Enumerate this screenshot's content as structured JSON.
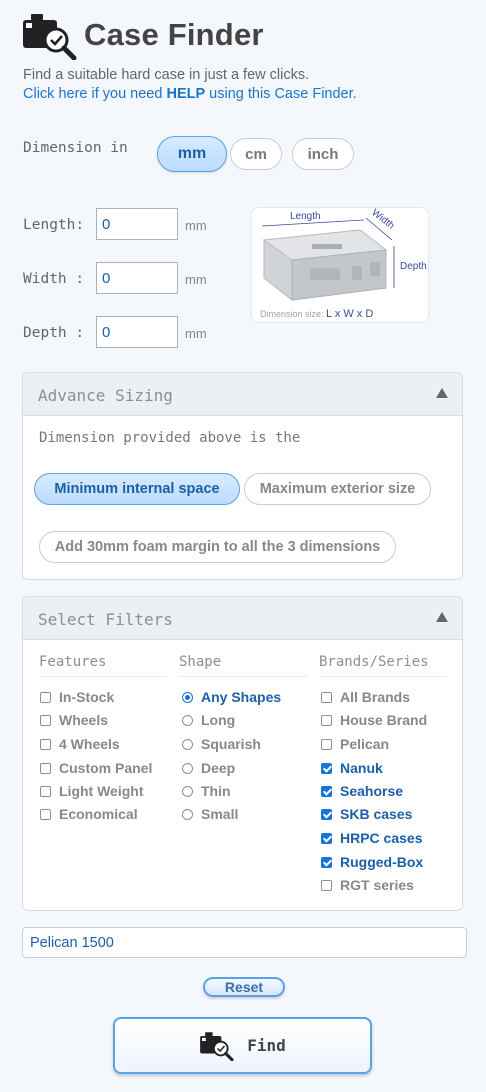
{
  "header": {
    "title": "Case Finder",
    "tagline": "Find a suitable hard case in just a few clicks.",
    "help_prefix": "Click here if you need ",
    "help_keyword": "HELP",
    "help_suffix": " using this Case Finder."
  },
  "units": {
    "label": "Dimension in",
    "options": [
      "mm",
      "cm",
      "inch"
    ],
    "selected": "mm"
  },
  "dimensions": {
    "length_label": "Length:",
    "width_label": "Width :",
    "depth_label": "Depth :",
    "length_value": "0",
    "width_value": "0",
    "depth_value": "0",
    "unit_suffix": "mm"
  },
  "diagram": {
    "length": "Length",
    "width": "Width",
    "depth": "Depth",
    "caption_prefix": "Dimension size:",
    "caption_formula": "L x W x D"
  },
  "advance_sizing": {
    "title": "Advance Sizing",
    "description": "Dimension provided above is the",
    "option_internal": "Minimum internal space",
    "option_exterior": "Maximum exterior size",
    "foam_margin": "Add 30mm foam margin to all the 3 dimensions",
    "selected": "Minimum internal space"
  },
  "filters": {
    "title": "Select Filters",
    "features": {
      "header": "Features",
      "items": [
        {
          "label": "In-Stock",
          "checked": false
        },
        {
          "label": "Wheels",
          "checked": false
        },
        {
          "label": "4 Wheels",
          "checked": false
        },
        {
          "label": "Custom Panel",
          "checked": false
        },
        {
          "label": "Light Weight",
          "checked": false
        },
        {
          "label": "Economical",
          "checked": false
        }
      ]
    },
    "shape": {
      "header": "Shape",
      "items": [
        {
          "label": "Any Shapes",
          "checked": true
        },
        {
          "label": "Long",
          "checked": false
        },
        {
          "label": "Squarish",
          "checked": false
        },
        {
          "label": "Deep",
          "checked": false
        },
        {
          "label": "Thin",
          "checked": false
        },
        {
          "label": "Small",
          "checked": false
        }
      ]
    },
    "brands": {
      "header": "Brands/Series",
      "items": [
        {
          "label": "All Brands",
          "checked": false
        },
        {
          "label": "House Brand",
          "checked": false
        },
        {
          "label": "Pelican",
          "checked": false
        },
        {
          "label": "Nanuk",
          "checked": true
        },
        {
          "label": "Seahorse",
          "checked": true
        },
        {
          "label": "SKB cases",
          "checked": true
        },
        {
          "label": "HRPC cases",
          "checked": true
        },
        {
          "label": "Rugged-Box",
          "checked": true
        },
        {
          "label": "RGT series",
          "checked": false
        }
      ]
    }
  },
  "search": {
    "value": "Pelican 1500"
  },
  "actions": {
    "reset": "Reset",
    "find": "Find"
  },
  "colors": {
    "accent": "#1a73d9",
    "link": "#1a75c8",
    "active_pill": "#bcdcff"
  }
}
